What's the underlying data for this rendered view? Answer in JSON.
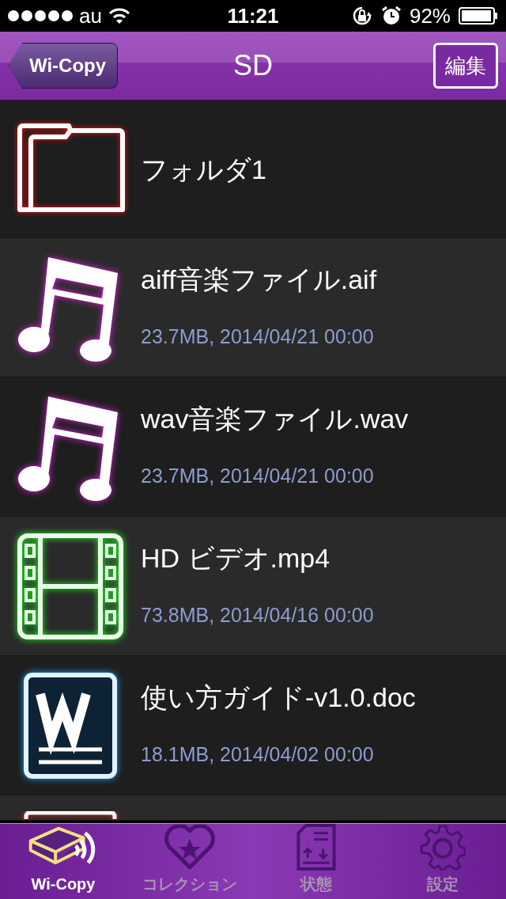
{
  "status_bar": {
    "carrier": "au",
    "time": "11:21",
    "battery": "92%"
  },
  "nav": {
    "back": "Wi-Copy",
    "title": "SD",
    "edit": "編集"
  },
  "items": [
    {
      "kind": "folder",
      "name": "フォルダ1"
    },
    {
      "kind": "music",
      "name": "aiff音楽ファイル.aif",
      "meta": "23.7MB, 2014/04/21 00:00"
    },
    {
      "kind": "music",
      "name": "wav音楽ファイル.wav",
      "meta": "23.7MB, 2014/04/21 00:00"
    },
    {
      "kind": "video",
      "name": "HD ビデオ.mp4",
      "meta": "73.8MB, 2014/04/16 00:00"
    },
    {
      "kind": "doc",
      "name": "使い方ガイド-v1.0.doc",
      "meta": "18.1MB, 2014/04/02 00:00"
    },
    {
      "kind": "partial"
    }
  ],
  "tabs": [
    {
      "kind": "wicopy",
      "label": "Wi-Copy",
      "selected": true
    },
    {
      "kind": "collection",
      "label": "コレクション",
      "selected": false
    },
    {
      "kind": "status",
      "label": "状態",
      "selected": false
    },
    {
      "kind": "settings",
      "label": "設定",
      "selected": false
    }
  ]
}
